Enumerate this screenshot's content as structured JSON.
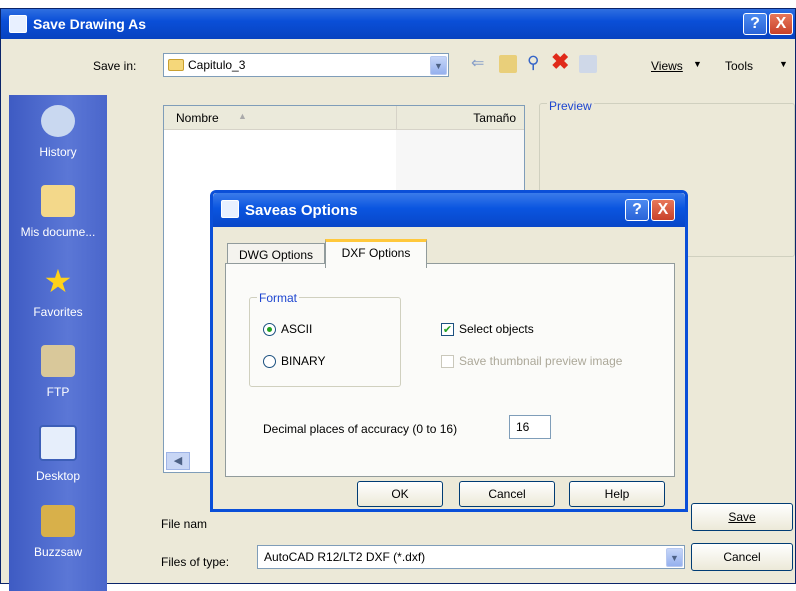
{
  "dialog": {
    "title": "Save Drawing As",
    "save_in_label": "Save in:",
    "save_in_value": "Capitulo_3",
    "views_label": "Views",
    "tools_label": "Tools",
    "help_glyph": "?",
    "close_glyph": "X",
    "columns": [
      "Nombre",
      "Tamaño"
    ],
    "preview_label": "Preview",
    "file_name_label": "File nam",
    "files_of_type_label": "Files of type:",
    "files_of_type_value": "AutoCAD R12/LT2 DXF (*.dxf)",
    "save_button": "Save",
    "cancel_button": "Cancel"
  },
  "places": [
    {
      "label": "History",
      "icon": "history-icon"
    },
    {
      "label": "Mis docume...",
      "icon": "folder-icon"
    },
    {
      "label": "Favorites",
      "icon": "star-icon"
    },
    {
      "label": "FTP",
      "icon": "ftp-icon"
    },
    {
      "label": "Desktop",
      "icon": "desktop-icon"
    },
    {
      "label": "Buzzsaw",
      "icon": "buzzsaw-icon"
    }
  ],
  "options": {
    "title": "Saveas Options",
    "tabs": [
      "DWG Options",
      "DXF Options"
    ],
    "active_tab": "DXF Options",
    "format_label": "Format",
    "ascii_label": "ASCII",
    "binary_label": "BINARY",
    "selected_format": "ASCII",
    "select_objects_label": "Select objects",
    "select_objects_checked": true,
    "save_thumbnail_label": "Save thumbnail preview image",
    "save_thumbnail_enabled": false,
    "decimal_label": "Decimal places of accuracy (0 to 16)",
    "decimal_value": "16",
    "ok_button": "OK",
    "cancel_button": "Cancel",
    "help_button": "Help"
  },
  "colors": {
    "title_bar": "#0a4fd8",
    "places_bar": "#4a66cb",
    "dialog_bg": "#ece9d8",
    "accent": "#1d45d0"
  }
}
